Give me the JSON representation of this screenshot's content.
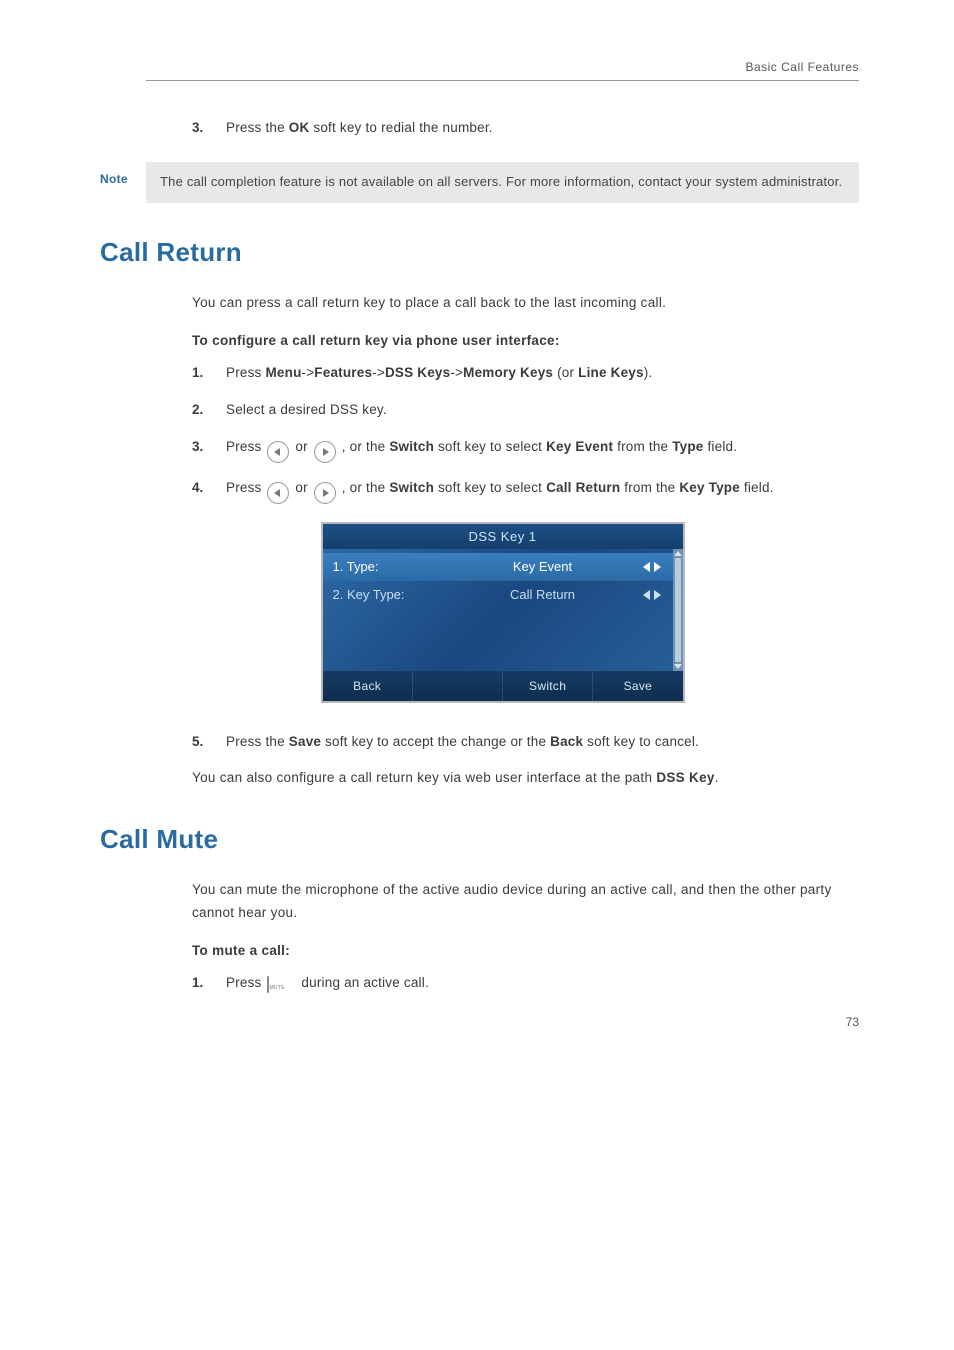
{
  "header": {
    "running": "Basic Call Features"
  },
  "step_top": {
    "num": "3.",
    "pre": "Press the ",
    "bold": "OK",
    "post": " soft key to redial the number."
  },
  "note": {
    "label": "Note",
    "text": "The call completion feature is not available on all servers. For more information, contact your system administrator."
  },
  "sec1": {
    "title": "Call Return",
    "intro": "You can press a call return key to place a call back to the last incoming call.",
    "configure": "To configure a call return key via phone user interface:",
    "s1": {
      "num": "1.",
      "p1": "Press ",
      "b1": "Menu",
      "a1": "->",
      "b2": "Features",
      "a2": "->",
      "b3": "DSS Keys",
      "a3": "->",
      "b4": "Memory Keys",
      "p2": " (or ",
      "b5": "Line Keys",
      "p3": ")."
    },
    "s2": {
      "num": "2.",
      "text": "Select a desired DSS key."
    },
    "s3": {
      "num": "3.",
      "p1": "Press ",
      "p2": " or ",
      "p3": " , or the ",
      "b1": "Switch",
      "p4": " soft key to select ",
      "b2": "Key Event",
      "p5": " from the ",
      "b3": "Type",
      "p6": " field."
    },
    "s4": {
      "num": "4.",
      "p1": "Press ",
      "p2": " or ",
      "p3": " , or the ",
      "b1": "Switch",
      "p4": " soft key to select ",
      "b2": "Call Return",
      "p5": " from the ",
      "b3": "Key Type",
      "p6": " field."
    },
    "screen": {
      "title": "DSS Key 1",
      "row1": {
        "label": "1. Type:",
        "value": "Key Event"
      },
      "row2": {
        "label": "2. Key Type:",
        "value": "Call Return"
      },
      "sk1": "Back",
      "sk2": "",
      "sk3": "Switch",
      "sk4": "Save"
    },
    "s5": {
      "num": "5.",
      "p1": "Press the ",
      "b1": "Save",
      "p2": " soft key to accept the change or the ",
      "b2": "Back",
      "p3": " soft key to cancel."
    },
    "outro_p1": "You can also configure a call return key via web user interface at the path ",
    "outro_b": "DSS Key",
    "outro_p2": "."
  },
  "sec2": {
    "title": "Call Mute",
    "intro": "You can mute the microphone of the active audio device during an active call, and then the other party cannot hear you.",
    "configure": "To mute a call:",
    "s1": {
      "num": "1.",
      "p1": "Press ",
      "p2": " during an active call."
    },
    "mute_label": "MUTE"
  },
  "page_number": "73"
}
